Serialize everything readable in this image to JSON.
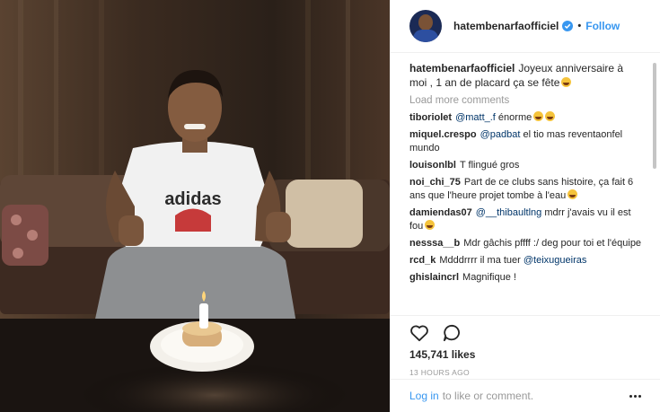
{
  "post": {
    "username": "hatembenarfaofficiel",
    "separator": "•",
    "follow_label": "Follow",
    "caption_user": "hatembenarfaofficiel",
    "caption_text": "Joyeux anniversaire à moi , 1 an de placard ça se fête",
    "load_more": "Load more comments",
    "likes": "145,741 likes",
    "time": "13 HOURS AGO",
    "login_label": "Log in",
    "login_rest": "to like or comment.",
    "photo_shirt_text": "adidas"
  },
  "comments": [
    {
      "user": "tiboriolet",
      "mention": "@matt_.f",
      "text": "énorme",
      "emoji": 2
    },
    {
      "user": "miquel.crespo",
      "mention": "@padbat",
      "text": "el tio mas reventaonfel mundo",
      "emoji": 0
    },
    {
      "user": "louisonlbl",
      "mention": "",
      "text": "T flingué gros",
      "emoji": 0
    },
    {
      "user": "noi_chi_75",
      "mention": "",
      "text": "Part de ce clubs sans histoire, ça fait 6 ans que l'heure projet tombe à l'eau",
      "emoji": 1
    },
    {
      "user": "damiendas07",
      "mention": "@__thibaultlng",
      "text": "mdrr j'avais vu il est fou",
      "emoji": 1
    },
    {
      "user": "nesssa__b",
      "mention": "",
      "text": "Mdr gâchis pffff :/ deg pour toi et l'équipe",
      "emoji": 0
    },
    {
      "user": "rcd_k",
      "mention": "",
      "text": "Mdddrrrr il ma tuer",
      "mention_after": "@teixugueiras",
      "emoji": 0
    },
    {
      "user": "ghislaincrl",
      "mention": "",
      "text": "Magnifique !",
      "emoji": 0
    }
  ],
  "colors": {
    "accent": "#3897f0",
    "mention": "#003569",
    "muted": "#999999"
  }
}
